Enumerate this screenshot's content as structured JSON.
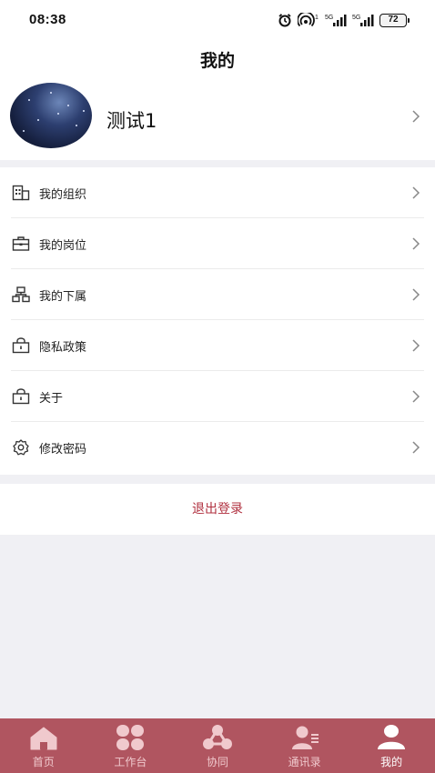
{
  "status_bar": {
    "time": "08:38",
    "icons": [
      "alarm-icon",
      "hotspot-icon",
      "signal-5g-icon",
      "signal-5g-icon"
    ],
    "battery": "72"
  },
  "header": {
    "title": "我的"
  },
  "profile": {
    "name": "测试1",
    "avatar": "starry-sky-avatar"
  },
  "menu": {
    "items": [
      {
        "label": "我的组织",
        "icon": "building-icon"
      },
      {
        "label": "我的岗位",
        "icon": "briefcase-icon"
      },
      {
        "label": "我的下属",
        "icon": "org-chart-icon"
      },
      {
        "label": "隐私政策",
        "icon": "lock-icon"
      },
      {
        "label": "关于",
        "icon": "lock-icon"
      },
      {
        "label": "修改密码",
        "icon": "gear-icon"
      }
    ]
  },
  "logout_label": "退出登录",
  "tabbar": {
    "items": [
      {
        "label": "首页",
        "icon": "home-icon",
        "active": false
      },
      {
        "label": "工作台",
        "icon": "grid-icon",
        "active": false
      },
      {
        "label": "协同",
        "icon": "team-icon",
        "active": false
      },
      {
        "label": "通讯录",
        "icon": "contacts-icon",
        "active": false
      },
      {
        "label": "我的",
        "icon": "user-icon",
        "active": true
      }
    ]
  },
  "colors": {
    "accent": "#b05560",
    "logout_text": "#b0303f",
    "page_bg": "#f0f0f4"
  }
}
